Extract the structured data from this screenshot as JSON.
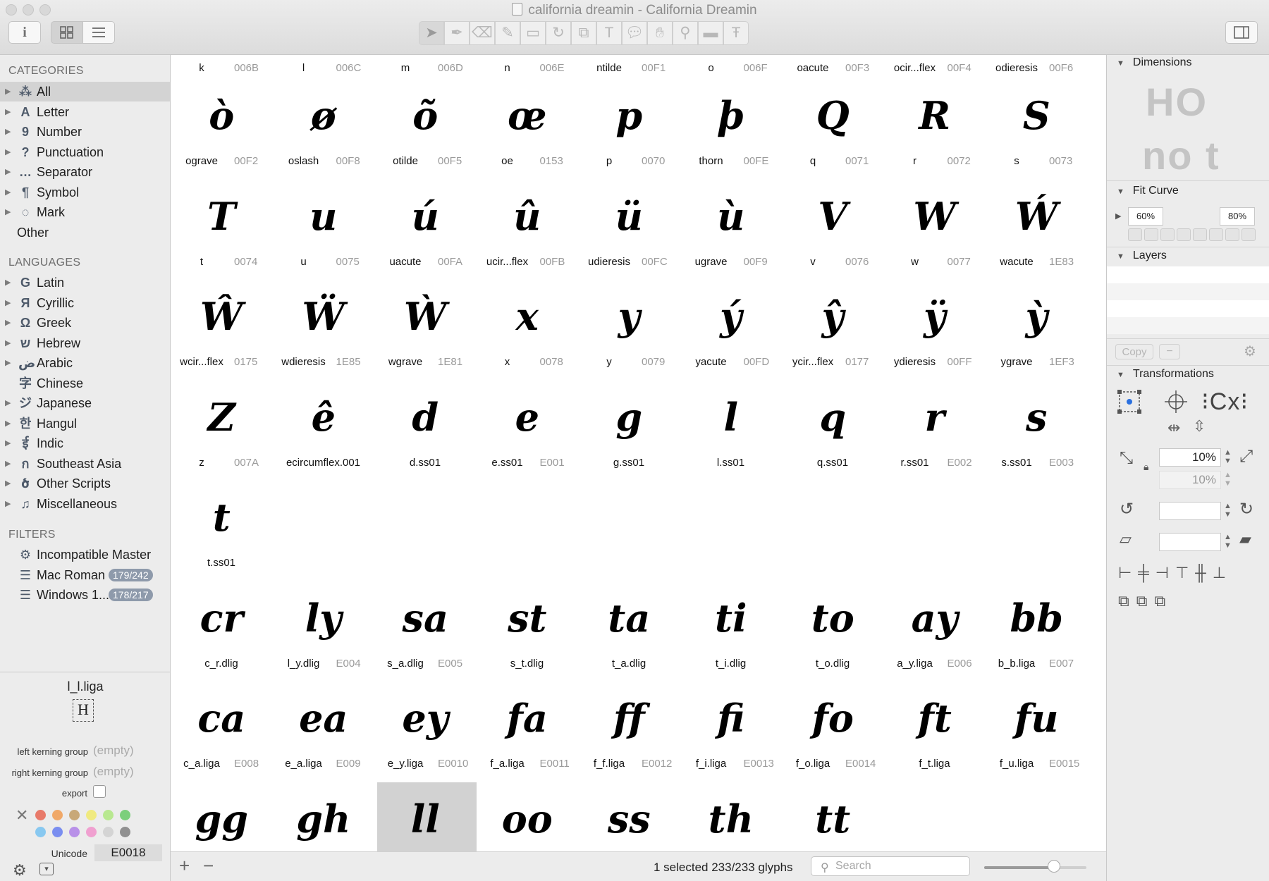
{
  "window": {
    "title": "california dreamin - California Dreamin"
  },
  "toolbar": {
    "info_icon": "i",
    "grid_view_icon": "grid-icon",
    "list_view_icon": "list-icon",
    "tools": [
      "select-tool-icon",
      "pen-tool-icon",
      "eraser-icon",
      "pencil-icon",
      "rect-icon",
      "rotate-icon",
      "scale-icon",
      "text-tool-icon",
      "annotation-icon",
      "hand-icon",
      "zoom-icon",
      "measure-icon",
      "anchor-text-icon"
    ]
  },
  "sidebar": {
    "categories_title": "CATEGORIES",
    "categories": [
      {
        "label": "All",
        "icon": "⁂",
        "selected": true
      },
      {
        "label": "Letter",
        "icon": "A"
      },
      {
        "label": "Number",
        "icon": "9"
      },
      {
        "label": "Punctuation",
        "icon": "?"
      },
      {
        "label": "Separator",
        "icon": "…"
      },
      {
        "label": "Symbol",
        "icon": "¶"
      },
      {
        "label": "Mark",
        "icon": "◌"
      },
      {
        "label": "Other",
        "icon": ""
      }
    ],
    "languages_title": "LANGUAGES",
    "languages": [
      {
        "label": "Latin",
        "icon": "G"
      },
      {
        "label": "Cyrillic",
        "icon": "Я"
      },
      {
        "label": "Greek",
        "icon": "Ω"
      },
      {
        "label": "Hebrew",
        "icon": "ש"
      },
      {
        "label": "Arabic",
        "icon": "ض"
      },
      {
        "label": "Chinese",
        "icon": "字"
      },
      {
        "label": "Japanese",
        "icon": "ジ"
      },
      {
        "label": "Hangul",
        "icon": "한"
      },
      {
        "label": "Indic",
        "icon": "ई"
      },
      {
        "label": "Southeast Asia",
        "icon": "ก"
      },
      {
        "label": "Other Scripts",
        "icon": "ծ"
      },
      {
        "label": "Miscellaneous",
        "icon": "♫"
      }
    ],
    "filters_title": "FILTERS",
    "filters": [
      {
        "label": "Incompatible Master",
        "icon": "⚙",
        "badge": ""
      },
      {
        "label": "Mac Roman",
        "icon": "☰",
        "badge": "179/242"
      },
      {
        "label": "Windows 1...",
        "icon": "☰",
        "badge": "178/217"
      }
    ]
  },
  "glyph_info": {
    "name": "l_l.liga",
    "preview": "H",
    "left_kerning_label": "left kerning group",
    "left_kerning_value": "(empty)",
    "right_kerning_label": "right kerning group",
    "right_kerning_value": "(empty)",
    "export_label": "export",
    "unicode_label": "Unicode",
    "unicode_value": "E0018",
    "colors": [
      "#e87a6a",
      "#f0a868",
      "#c8a878",
      "#f0ea80",
      "#b8e890",
      "#7ccf7c",
      "#88c8f0",
      "#7a8ef0",
      "#b890e8",
      "#f0a0d0",
      "#d4d4d4",
      "#909090"
    ]
  },
  "header_row": [
    {
      "name": "k",
      "code": "006B"
    },
    {
      "name": "l",
      "code": "006C"
    },
    {
      "name": "m",
      "code": "006D"
    },
    {
      "name": "n",
      "code": "006E"
    },
    {
      "name": "ntilde",
      "code": "00F1"
    },
    {
      "name": "o",
      "code": "006F"
    },
    {
      "name": "oacute",
      "code": "00F3"
    },
    {
      "name": "ocir...flex",
      "code": "00F4"
    },
    {
      "name": "odieresis",
      "code": "00F6"
    }
  ],
  "rows": [
    [
      {
        "g": "ò",
        "name": "ograve",
        "code": "00F2"
      },
      {
        "g": "ø",
        "name": "oslash",
        "code": "00F8"
      },
      {
        "g": "õ",
        "name": "otilde",
        "code": "00F5"
      },
      {
        "g": "œ",
        "name": "oe",
        "code": "0153"
      },
      {
        "g": "p",
        "name": "p",
        "code": "0070"
      },
      {
        "g": "þ",
        "name": "thorn",
        "code": "00FE"
      },
      {
        "g": "Q",
        "name": "q",
        "code": "0071"
      },
      {
        "g": "R",
        "name": "r",
        "code": "0072"
      },
      {
        "g": "S",
        "name": "s",
        "code": "0073"
      }
    ],
    [
      {
        "g": "T",
        "name": "t",
        "code": "0074"
      },
      {
        "g": "u",
        "name": "u",
        "code": "0075"
      },
      {
        "g": "ú",
        "name": "uacute",
        "code": "00FA"
      },
      {
        "g": "û",
        "name": "ucir...flex",
        "code": "00FB"
      },
      {
        "g": "ü",
        "name": "udieresis",
        "code": "00FC"
      },
      {
        "g": "ù",
        "name": "ugrave",
        "code": "00F9"
      },
      {
        "g": "V",
        "name": "v",
        "code": "0076"
      },
      {
        "g": "W",
        "name": "w",
        "code": "0077"
      },
      {
        "g": "Ẃ",
        "name": "wacute",
        "code": "1E83"
      }
    ],
    [
      {
        "g": "Ŵ",
        "name": "wcir...flex",
        "code": "0175"
      },
      {
        "g": "Ẅ",
        "name": "wdieresis",
        "code": "1E85"
      },
      {
        "g": "Ẁ",
        "name": "wgrave",
        "code": "1E81"
      },
      {
        "g": "x",
        "name": "x",
        "code": "0078"
      },
      {
        "g": "y",
        "name": "y",
        "code": "0079"
      },
      {
        "g": "ý",
        "name": "yacute",
        "code": "00FD"
      },
      {
        "g": "ŷ",
        "name": "ycir...flex",
        "code": "0177"
      },
      {
        "g": "ÿ",
        "name": "ydieresis",
        "code": "00FF"
      },
      {
        "g": "ỳ",
        "name": "ygrave",
        "code": "1EF3"
      }
    ],
    [
      {
        "g": "Z",
        "name": "z",
        "code": "007A"
      },
      {
        "g": "ê",
        "name": "ecircumflex.001",
        "code": ""
      },
      {
        "g": "d",
        "name": "d.ss01",
        "code": ""
      },
      {
        "g": "e",
        "name": "e.ss01",
        "code": "E001"
      },
      {
        "g": "g",
        "name": "g.ss01",
        "code": ""
      },
      {
        "g": "l",
        "name": "l.ss01",
        "code": ""
      },
      {
        "g": "q",
        "name": "q.ss01",
        "code": ""
      },
      {
        "g": "r",
        "name": "r.ss01",
        "code": "E002"
      },
      {
        "g": "s",
        "name": "s.ss01",
        "code": "E003"
      }
    ],
    [
      {
        "g": "t",
        "name": "t.ss01",
        "code": ""
      }
    ],
    [
      {
        "g": "cr",
        "name": "c_r.dlig",
        "code": ""
      },
      {
        "g": "ly",
        "name": "l_y.dlig",
        "code": "E004"
      },
      {
        "g": "sa",
        "name": "s_a.dlig",
        "code": "E005"
      },
      {
        "g": "st",
        "name": "s_t.dlig",
        "code": ""
      },
      {
        "g": "ta",
        "name": "t_a.dlig",
        "code": ""
      },
      {
        "g": "ti",
        "name": "t_i.dlig",
        "code": ""
      },
      {
        "g": "to",
        "name": "t_o.dlig",
        "code": ""
      },
      {
        "g": "ay",
        "name": "a_y.liga",
        "code": "E006"
      },
      {
        "g": "bb",
        "name": "b_b.liga",
        "code": "E007"
      }
    ],
    [
      {
        "g": "ca",
        "name": "c_a.liga",
        "code": "E008"
      },
      {
        "g": "ea",
        "name": "e_a.liga",
        "code": "E009"
      },
      {
        "g": "ey",
        "name": "e_y.liga",
        "code": "E0010"
      },
      {
        "g": "fa",
        "name": "f_a.liga",
        "code": "E0011"
      },
      {
        "g": "ff",
        "name": "f_f.liga",
        "code": "E0012"
      },
      {
        "g": "fi",
        "name": "f_i.liga",
        "code": "E0013"
      },
      {
        "g": "fo",
        "name": "f_o.liga",
        "code": "E0014"
      },
      {
        "g": "ft",
        "name": "f_t.liga",
        "code": ""
      },
      {
        "g": "fu",
        "name": "f_u.liga",
        "code": "E0015"
      }
    ],
    [
      {
        "g": "gg",
        "name": "",
        "code": ""
      },
      {
        "g": "gh",
        "name": "",
        "code": ""
      },
      {
        "g": "ll",
        "name": "",
        "code": "",
        "selected": true
      },
      {
        "g": "oo",
        "name": "",
        "code": ""
      },
      {
        "g": "ss",
        "name": "",
        "code": ""
      },
      {
        "g": "th",
        "name": "",
        "code": ""
      },
      {
        "g": "tt",
        "name": "",
        "code": ""
      }
    ]
  ],
  "status": {
    "text": "1 selected 233/233 glyphs",
    "search_placeholder": "Search",
    "add_icon": "+",
    "remove_icon": "−",
    "zoom_fraction": 0.68
  },
  "inspector": {
    "dimensions_title": "Dimensions",
    "dim_preview_top": "HO",
    "dim_preview_bottom": "no t",
    "fit_curve_title": "Fit Curve",
    "fit_low": "60%",
    "fit_high": "80%",
    "layers_title": "Layers",
    "copy_label": "Copy",
    "transformations_title": "Transformations",
    "scale_x": "10%",
    "scale_y": "10%",
    "rotate_value": "",
    "slant_value": ""
  }
}
